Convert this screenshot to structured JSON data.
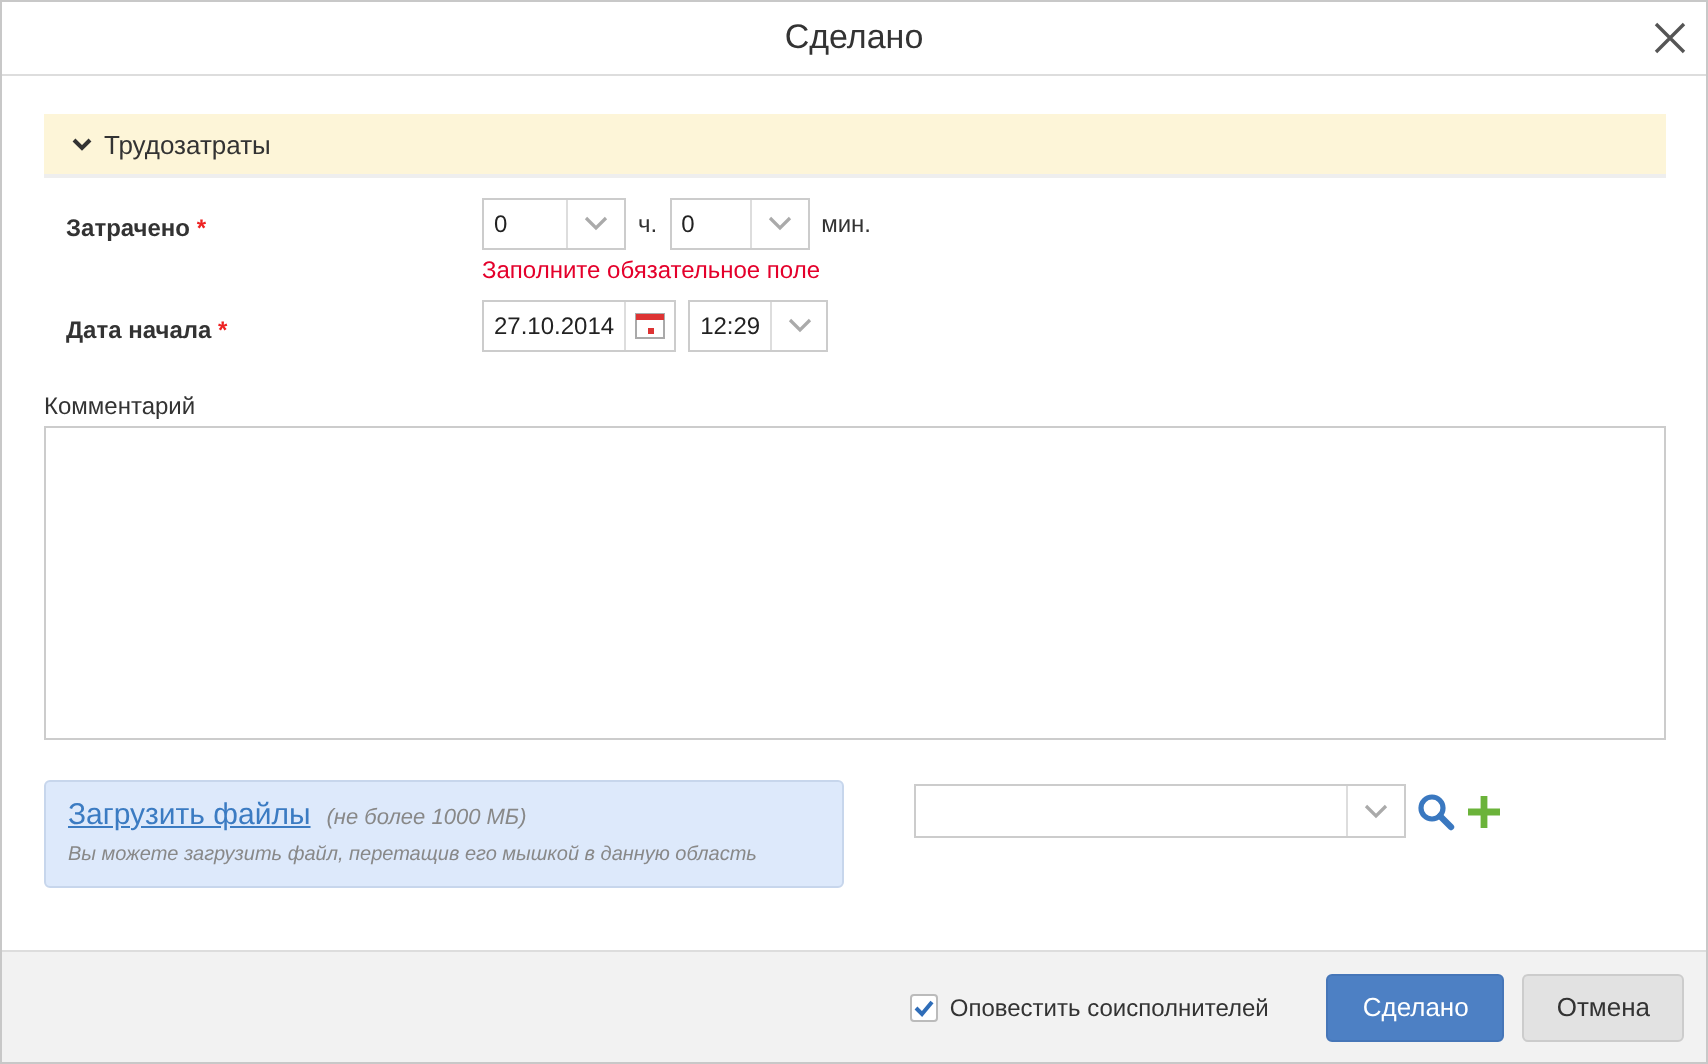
{
  "window": {
    "title": "Сделано"
  },
  "section": {
    "title": "Трудозатраты",
    "expanded": true
  },
  "spent": {
    "label": "Затрачено",
    "required_mark": "*",
    "hours": "0",
    "hours_unit": "ч.",
    "minutes": "0",
    "minutes_unit": "мин.",
    "error": "Заполните обязательное поле"
  },
  "start": {
    "label": "Дата начала",
    "required_mark": "*",
    "date": "27.10.2014",
    "time": "12:29"
  },
  "comment": {
    "label": "Комментарий"
  },
  "upload": {
    "link": "Загрузить файлы",
    "limit": "(не более 1000 МБ)",
    "hint": "Вы можете загрузить файл, перетащив его мышкой в данную область"
  },
  "footer": {
    "notify": {
      "label": "Оповестить соисполнителей",
      "checked": true
    },
    "buttons": [
      {
        "label": "Сделано",
        "kind": "primary"
      },
      {
        "label": "Отмена",
        "kind": "secondary"
      }
    ]
  }
}
